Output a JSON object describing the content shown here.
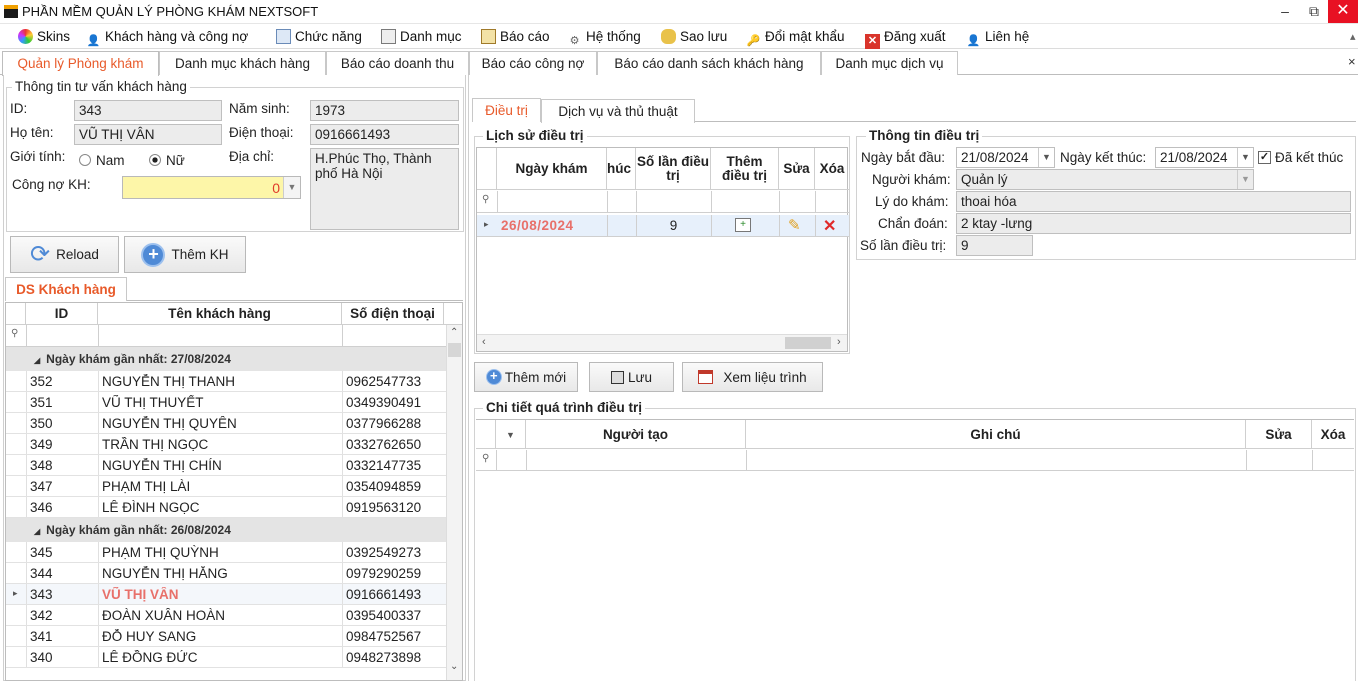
{
  "window": {
    "title": "PHẦN MỀM QUẢN LÝ PHÒNG KHÁM NEXTSOFT",
    "minimize": "–",
    "restore": "⧉",
    "close": "✕"
  },
  "menu": [
    {
      "label": "Skins",
      "icon": "skins-icon"
    },
    {
      "label": "Khách hàng và công nợ",
      "icon": "customer-icon"
    },
    {
      "label": "Chức năng",
      "icon": "function-icon"
    },
    {
      "label": "Danh mục",
      "icon": "catalog-icon"
    },
    {
      "label": "Báo cáo",
      "icon": "report-icon"
    },
    {
      "label": "Hệ thống",
      "icon": "system-icon"
    },
    {
      "label": "Sao lưu",
      "icon": "backup-icon"
    },
    {
      "label": "Đổi mật khẩu",
      "icon": "password-icon"
    },
    {
      "label": "Đăng xuất",
      "icon": "logout-icon"
    },
    {
      "label": "Liên hệ",
      "icon": "contact-icon"
    }
  ],
  "tabs": [
    "Quản lý Phòng khám",
    "Danh mục khách hàng",
    "Báo cáo doanh thu",
    "Báo cáo công nợ",
    "Báo cáo danh sách khách hàng",
    "Danh mục dịch vụ"
  ],
  "tab_close": "×",
  "customer_info": {
    "title": "Thông tin tư vấn khách hàng",
    "id_label": "ID:",
    "id": "343",
    "birth_label": "Năm sinh:",
    "birth": "1973",
    "name_label": "Họ tên:",
    "name": "VŨ THỊ VÂN",
    "phone_label": "Điện thoại:",
    "phone": "0916661493",
    "gender_label": "Giới tính:",
    "male": "Nam",
    "female": "Nữ",
    "address_label": "Địa chỉ:",
    "address": "H.Phúc Thọ, Thành phố Hà Nội",
    "debt_label": "Công nợ KH:",
    "debt": "0"
  },
  "buttons": {
    "reload": "Reload",
    "add_customer": "Thêm KH",
    "add_new": "Thêm mới",
    "save": "Lưu",
    "view_course": "Xem liệu trình"
  },
  "customer_list": {
    "tab": "DS Khách hàng",
    "headers": [
      "ID",
      "Tên khách hàng",
      "Số điện thoại"
    ],
    "groups": [
      {
        "label": "Ngày khám gần nhất: 27/08/2024",
        "rows": [
          [
            "352",
            "NGUYỄN THỊ THANH",
            "0962547733"
          ],
          [
            "351",
            "VŨ THỊ THUYẾT",
            "0349390491"
          ],
          [
            "350",
            "NGUYỄN THỊ QUYÊN",
            "0377966288"
          ],
          [
            "349",
            "TRẦN THỊ NGỌC",
            "0332762650"
          ],
          [
            "348",
            "NGUYỄN THỊ CHÍN",
            "0332147735"
          ],
          [
            "347",
            "PHẠM THỊ LÀI",
            "0354094859"
          ],
          [
            "346",
            "LÊ ĐÌNH NGỌC",
            "0919563120"
          ]
        ]
      },
      {
        "label": "Ngày khám gần nhất: 26/08/2024",
        "rows": [
          [
            "345",
            "PHẠM THỊ QUỲNH",
            "0392549273"
          ],
          [
            "344",
            "NGUYỄN THỊ HẰNG",
            "0979290259"
          ],
          [
            "343",
            "VŨ THỊ VÂN",
            "0916661493"
          ],
          [
            "342",
            "ĐOÀN XUÂN HOÀN",
            "0395400337"
          ],
          [
            "341",
            "ĐỖ HUY SANG",
            "0984752567"
          ],
          [
            "340",
            "LÊ ĐỒNG ĐỨC",
            "0948273898"
          ]
        ]
      }
    ]
  },
  "treatment_tabs": [
    "Điều trị",
    "Dịch vụ và thủ thuật"
  ],
  "history": {
    "title": "Lịch sử điều trị",
    "headers": [
      "Ngày khám",
      "húc",
      "Số lần điều trị",
      "Thêm điều trị",
      "Sửa",
      "Xóa"
    ],
    "rows": [
      {
        "date": "26/08/2024",
        "count": "9"
      }
    ]
  },
  "treatment_info": {
    "title": "Thông tin điều trị",
    "start_label": "Ngày bắt đầu:",
    "start": "21/08/2024",
    "end_label": "Ngày kết thúc:",
    "end": "21/08/2024",
    "done_label": "Đã kết thúc",
    "doctor_label": "Người khám:",
    "doctor": "Quản lý",
    "reason_label": "Lý do khám:",
    "reason": "thoai hóa",
    "diagnosis_label": "Chẩn đoán:",
    "diagnosis": "2 ktay -lưng",
    "count_label": "Số lần điều trị:",
    "count": "9"
  },
  "details": {
    "title": "Chi tiết quá trình điều trị",
    "headers": [
      "Người tạo",
      "Ghi chú",
      "Sửa",
      "Xóa"
    ]
  },
  "colors": {
    "accent": "#e85a2a",
    "selected_text": "#e8706a"
  }
}
